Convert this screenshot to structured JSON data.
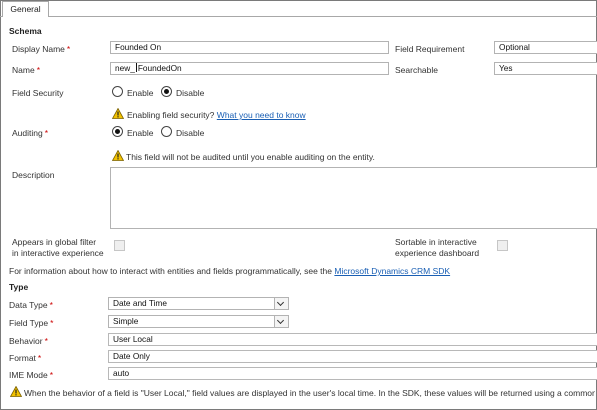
{
  "tabs": {
    "general": "General"
  },
  "schema": {
    "heading": "Schema",
    "display_name": {
      "label": "Display Name",
      "value": "Founded On"
    },
    "name": {
      "label": "Name",
      "prefix": "new_",
      "value": "FoundedOn"
    },
    "field_requirement": {
      "label": "Field Requirement",
      "value": "Optional"
    },
    "searchable": {
      "label": "Searchable",
      "value": "Yes"
    },
    "field_security": {
      "label": "Field Security",
      "enable": "Enable",
      "disable": "Disable",
      "selected": "disable",
      "warning": "Enabling field security?",
      "warning_link": "What you need to know"
    },
    "auditing": {
      "label": "Auditing",
      "enable": "Enable",
      "disable": "Disable",
      "selected": "enable",
      "warning": "This field will not be audited until you enable auditing on the entity."
    },
    "description": {
      "label": "Description",
      "value": ""
    },
    "global_filter": {
      "label_line1": "Appears in global filter",
      "label_line2": "in interactive experience",
      "checked": false
    },
    "sortable": {
      "label_line1": "Sortable in interactive",
      "label_line2": "experience dashboard",
      "checked": false
    },
    "sdk_info": {
      "text": "For information about how to interact with entities and fields programmatically, see the",
      "link": "Microsoft Dynamics CRM SDK"
    }
  },
  "type": {
    "heading": "Type",
    "data_type": {
      "label": "Data Type",
      "value": "Date and Time"
    },
    "field_type": {
      "label": "Field Type",
      "value": "Simple"
    },
    "behavior": {
      "label": "Behavior",
      "value": "User Local"
    },
    "format": {
      "label": "Format",
      "value": "Date Only"
    },
    "ime_mode": {
      "label": "IME Mode",
      "value": "auto"
    },
    "behavior_note": "When the behavior of a field is \"User Local,\" field values are displayed in the user's local time. In the SDK, these values will be returned using a common"
  },
  "required_mark": "*",
  "colors": {
    "link": "#1a5fb4",
    "required": "#cc0000",
    "warning": "#f2c200"
  }
}
